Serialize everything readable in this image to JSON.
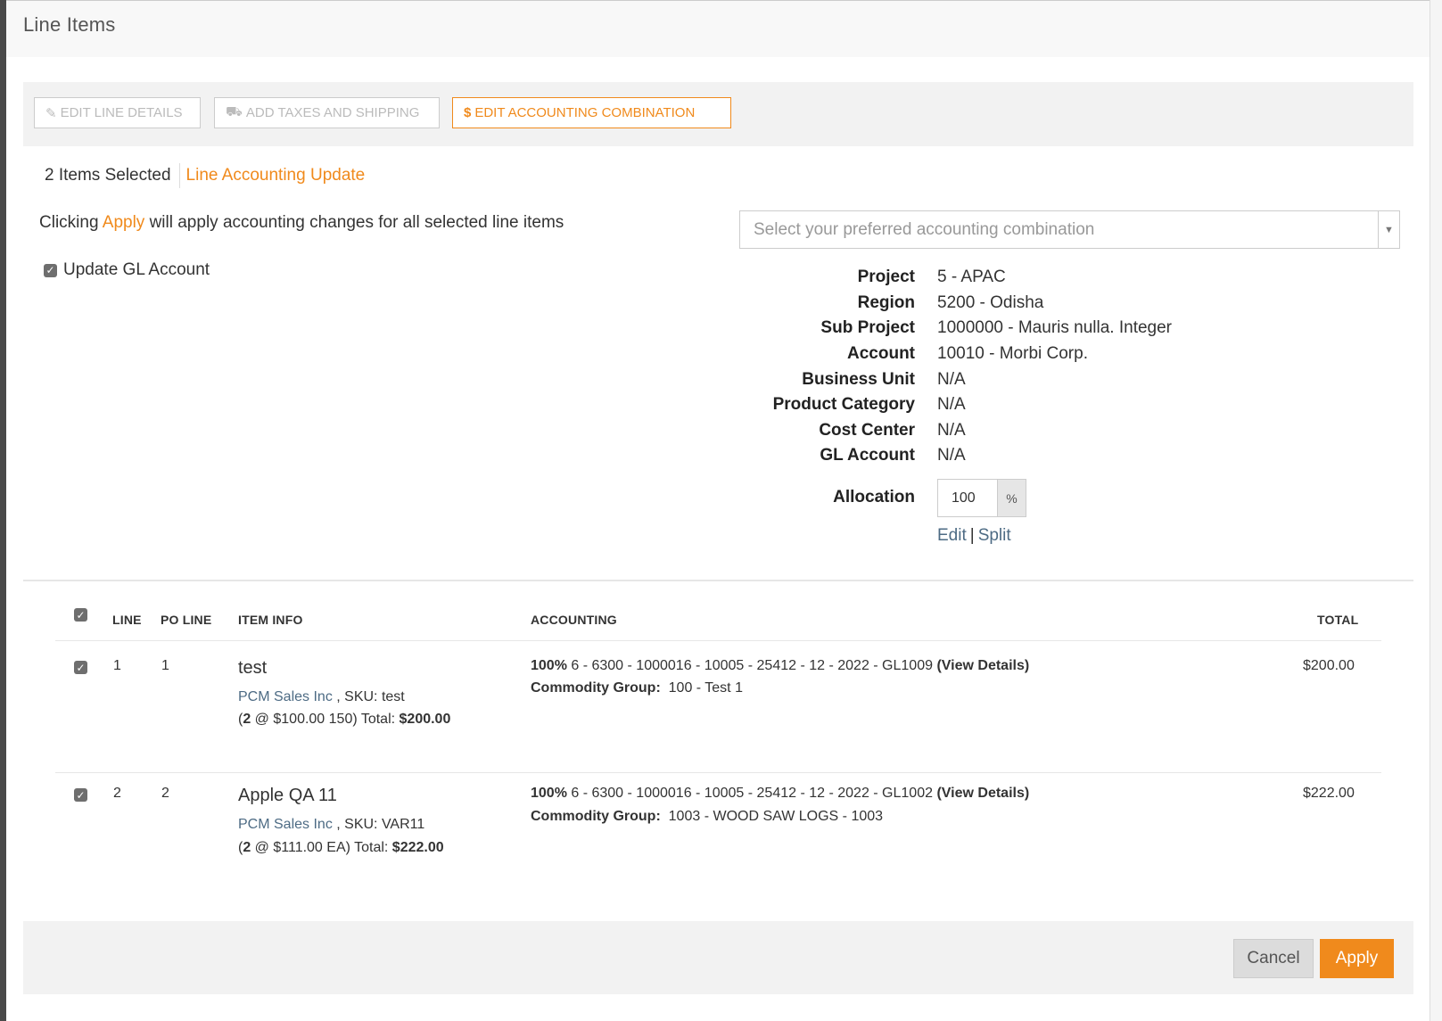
{
  "header": {
    "title": "Line Items"
  },
  "toolbar": {
    "edit_line_details": "EDIT LINE DETAILS",
    "add_taxes_shipping": "ADD TAXES AND SHIPPING",
    "edit_accounting": "EDIT ACCOUNTING COMBINATION"
  },
  "selection": {
    "count_text": "2 Items Selected",
    "mode_label": "Line Accounting Update"
  },
  "info": {
    "prefix": "Clicking",
    "apply_word": "Apply",
    "suffix": "will apply accounting changes for all selected line items"
  },
  "update_gl": {
    "label": "Update GL Account",
    "checked": true
  },
  "combo": {
    "placeholder": "Select your preferred accounting combination"
  },
  "details": [
    {
      "key": "Project",
      "value": "5 - APAC"
    },
    {
      "key": "Region",
      "value": "5200 - Odisha"
    },
    {
      "key": "Sub Project",
      "value": "1000000 - Mauris nulla. Integer"
    },
    {
      "key": "Account",
      "value": "10010 - Morbi Corp."
    },
    {
      "key": "Business Unit",
      "value": "N/A"
    },
    {
      "key": "Product Category",
      "value": "N/A"
    },
    {
      "key": "Cost Center",
      "value": "N/A"
    },
    {
      "key": "GL Account",
      "value": "N/A"
    }
  ],
  "allocation": {
    "label": "Allocation",
    "value": "100",
    "unit": "%",
    "edit": "Edit",
    "separator": "|",
    "split": "Split"
  },
  "table": {
    "headers": {
      "line": "LINE",
      "po_line": "PO LINE",
      "item_info": "ITEM INFO",
      "accounting": "ACCOUNTING",
      "total": "TOTAL"
    },
    "rows": [
      {
        "line": "1",
        "po_line": "1",
        "title": "test",
        "supplier": "PCM Sales Inc",
        "sku": ", SKU: test",
        "qty": "2",
        "price_text": " @ $100.00 150) Total: ",
        "total_bold": "$200.00",
        "pct": "100%",
        "combo": " 6 - 6300 - 1000016 - 10005 - 25412 - 12 - 2022 - GL1009 ",
        "view": "(View Details)",
        "commodity_label": "Commodity Group:",
        "commodity": "100 - Test 1",
        "total": "$200.00"
      },
      {
        "line": "2",
        "po_line": "2",
        "title": "Apple QA 11",
        "supplier": "PCM Sales Inc",
        "sku": ", SKU: VAR11",
        "qty": "2",
        "price_text": " @ $111.00 EA) Total: ",
        "total_bold": "$222.00",
        "pct": "100%",
        "combo": " 6 - 6300 - 1000016 - 10005 - 25412 - 12 - 2022 - GL1002 ",
        "view": "(View Details)",
        "commodity_label": "Commodity Group:",
        "commodity": "1003 - WOOD SAW LOGS - 1003",
        "total": "$222.00"
      }
    ]
  },
  "footer": {
    "cancel": "Cancel",
    "apply": "Apply"
  },
  "colors": {
    "accent": "#f08a1c",
    "link": "#4d6b84"
  }
}
